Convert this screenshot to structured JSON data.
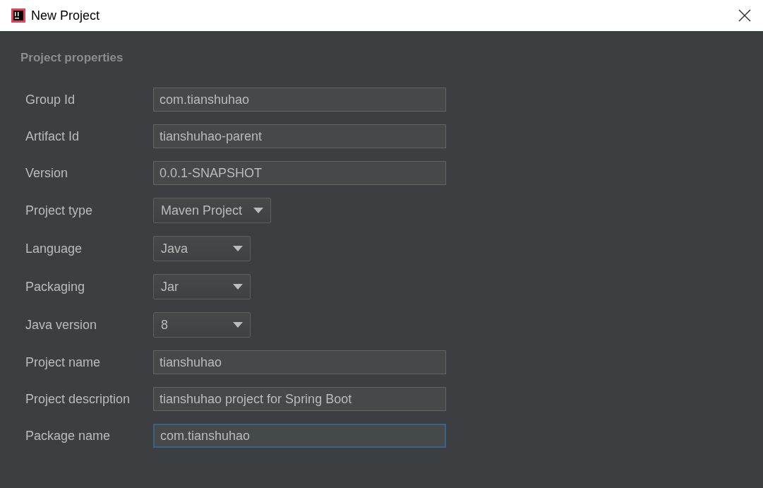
{
  "window": {
    "title": "New Project"
  },
  "section": {
    "title": "Project properties"
  },
  "fields": [
    {
      "kind": "text",
      "label": "Group Id",
      "value": "com.tianshuhao",
      "focused": false
    },
    {
      "kind": "text",
      "label": "Artifact Id",
      "value": "tianshuhao-parent",
      "focused": false
    },
    {
      "kind": "text",
      "label": "Version",
      "value": "0.0.1-SNAPSHOT",
      "focused": false
    },
    {
      "kind": "select",
      "label": "Project type",
      "value": "Maven Project",
      "focused": false
    },
    {
      "kind": "select",
      "label": "Language",
      "value": "Java",
      "focused": false
    },
    {
      "kind": "select",
      "label": "Packaging",
      "value": "Jar",
      "focused": false
    },
    {
      "kind": "select",
      "label": "Java version",
      "value": "8",
      "focused": false
    },
    {
      "kind": "text",
      "label": "Project name",
      "value": "tianshuhao",
      "focused": false
    },
    {
      "kind": "text",
      "label": "Project description",
      "value": "tianshuhao project for Spring Boot",
      "focused": false
    },
    {
      "kind": "text",
      "label": "Package name",
      "value": "com.tianshuhao",
      "focused": true
    }
  ]
}
